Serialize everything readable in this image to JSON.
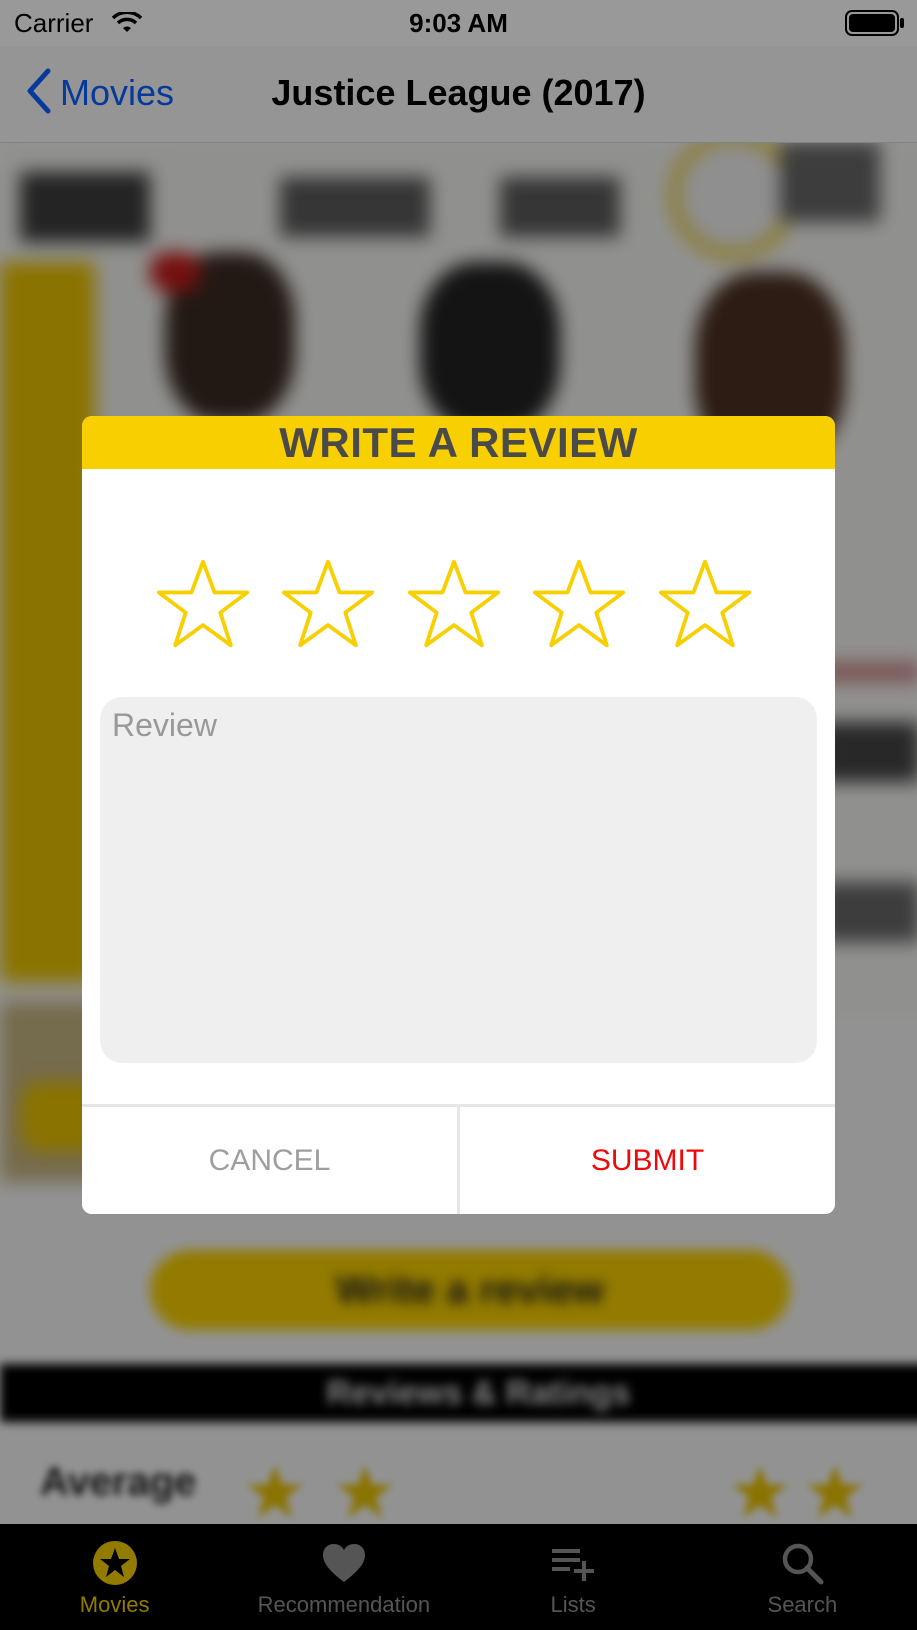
{
  "status_bar": {
    "carrier": "Carrier",
    "time": "9:03 AM"
  },
  "nav": {
    "back_label": "Movies",
    "title": "Justice League (2017)"
  },
  "background": {
    "write_review_button": "Write a review",
    "banner_text": "Reviews & Ratings",
    "average_label": "Average"
  },
  "dialog": {
    "title": "WRITE A REVIEW",
    "rating": {
      "value": 0,
      "max": 5
    },
    "review_placeholder": "Review",
    "review_value": "",
    "cancel_label": "CANCEL",
    "submit_label": "SUBMIT"
  },
  "tabs": [
    {
      "label": "Movies",
      "icon": "star-badge-icon",
      "active": true
    },
    {
      "label": "Recommendation",
      "icon": "heart-icon",
      "active": false
    },
    {
      "label": "Lists",
      "icon": "playlist-add-icon",
      "active": false
    },
    {
      "label": "Search",
      "icon": "magnifier-icon",
      "active": false
    }
  ],
  "colors": {
    "accent_yellow": "#F8CF00",
    "ios_blue": "#0A60FF",
    "submit_red": "#EE0A0A",
    "cancel_gray": "#9E9E9E"
  }
}
